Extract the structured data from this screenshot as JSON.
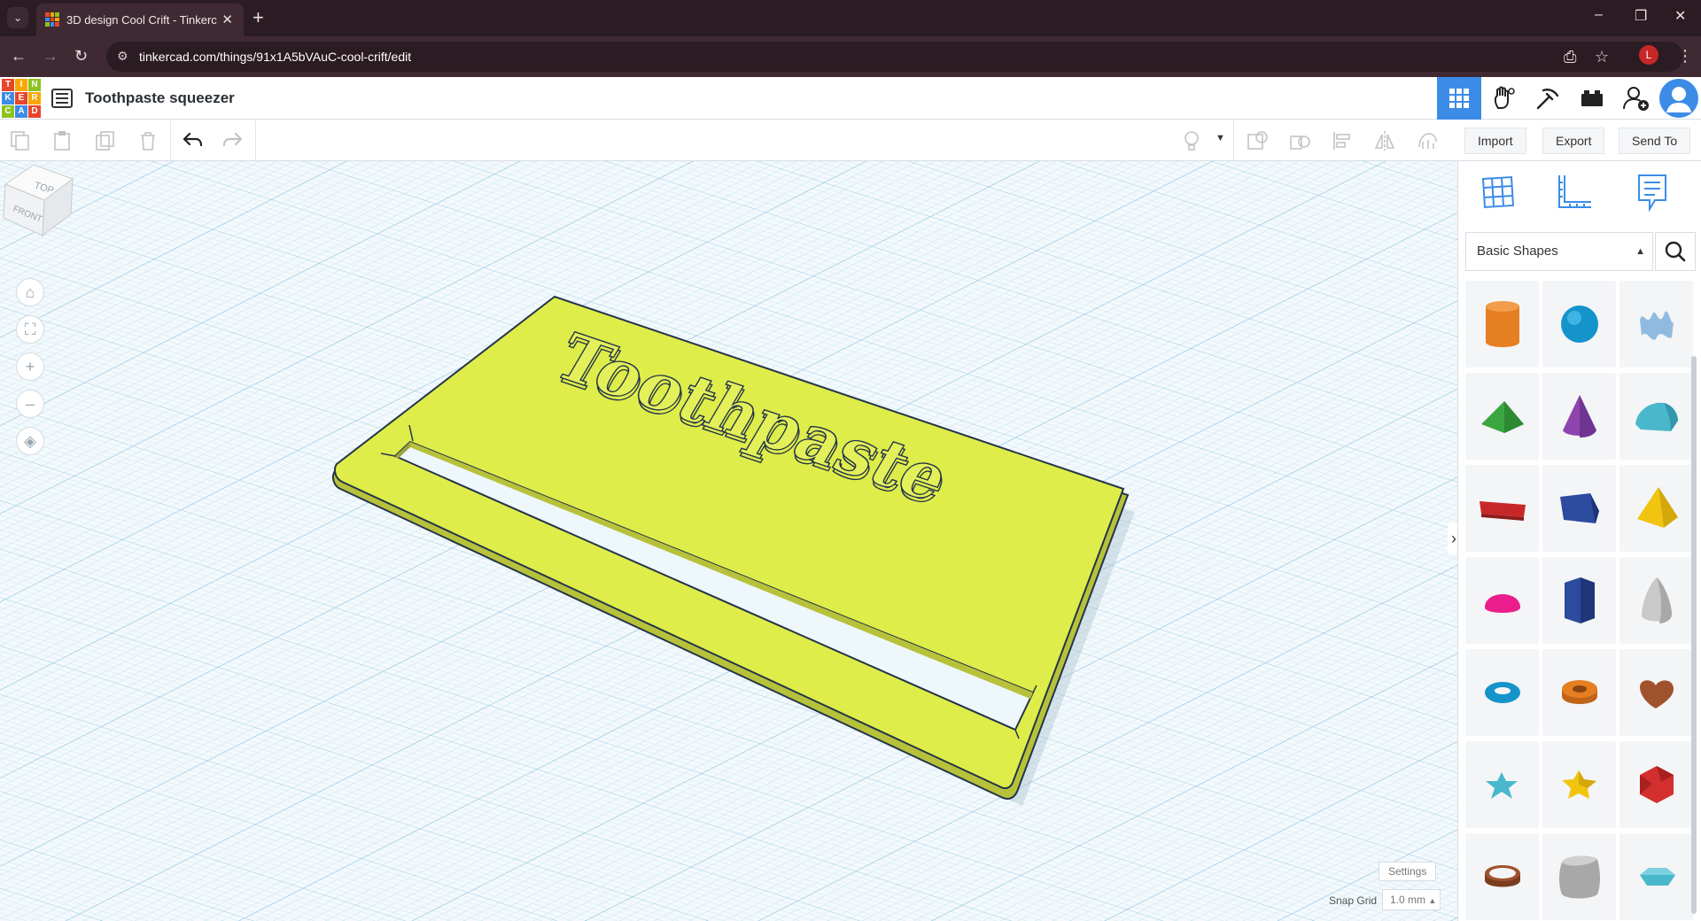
{
  "browser": {
    "tab_title": "3D design Cool Crift - Tinkercad",
    "tab_close": "✕",
    "new_tab": "+",
    "url": "tinkercad.com/things/91x1A5bVAuC-cool-crift/edit",
    "profile_initial": "L"
  },
  "app": {
    "logo_letters": [
      "T",
      "I",
      "N",
      "K",
      "E",
      "R",
      "C",
      "A",
      "D"
    ],
    "logo_colors": [
      "#e8452c",
      "#f7a800",
      "#8ec21f",
      "#3c8ce7",
      "#e8452c",
      "#f7a800",
      "#8ec21f",
      "#3c8ce7",
      "#e8452c"
    ],
    "design_title": "Toothpaste squeezer",
    "accent": "#3c8ce7"
  },
  "toolbar": {
    "import_label": "Import",
    "export_label": "Export",
    "send_to_label": "Send To"
  },
  "workplane": {
    "viewcube_top": "TOP",
    "viewcube_front": "FRONT",
    "model_text": "Toothpaste",
    "model_color": "#dfed4a",
    "settings_label": "Settings",
    "snap_grid_label": "Snap Grid",
    "snap_grid_value": "1.0 mm"
  },
  "panel": {
    "category": "Basic Shapes",
    "shapes": [
      {
        "name": "cylinder",
        "color": "#e67e22"
      },
      {
        "name": "sphere",
        "color": "#1aa0d8"
      },
      {
        "name": "scribble",
        "color": "#7fb0d8"
      },
      {
        "name": "roof",
        "color": "#3aa640"
      },
      {
        "name": "cone",
        "color": "#8e44ad"
      },
      {
        "name": "round-roof",
        "color": "#4ab8cc"
      },
      {
        "name": "text",
        "color": "#d32f2f"
      },
      {
        "name": "box",
        "color": "#2c4a9e"
      },
      {
        "name": "pyramid",
        "color": "#f1c40f"
      },
      {
        "name": "half-sphere",
        "color": "#e91e8c"
      },
      {
        "name": "polygon",
        "color": "#2c4a9e"
      },
      {
        "name": "paraboloid",
        "color": "#bdbdbd"
      },
      {
        "name": "torus",
        "color": "#1aa0d8"
      },
      {
        "name": "tube",
        "color": "#e67e22"
      },
      {
        "name": "heart",
        "color": "#a0522d"
      },
      {
        "name": "star",
        "color": "#4ab8cc"
      },
      {
        "name": "star-gold",
        "color": "#f1c40f"
      },
      {
        "name": "icosahedron",
        "color": "#d32f2f"
      },
      {
        "name": "ring",
        "color": "#a0522d"
      },
      {
        "name": "rounded-box",
        "color": "#9e9e9e"
      },
      {
        "name": "gem",
        "color": "#4ab8cc"
      }
    ]
  }
}
